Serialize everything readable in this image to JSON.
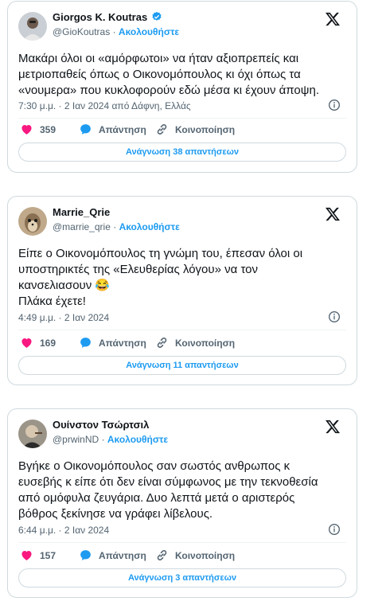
{
  "tweets": [
    {
      "name": "Giorgos K. Koutras",
      "verified": true,
      "handle": "@GioKoutras",
      "follow_label": "Ακολουθήστε",
      "text": "Μακάρι όλοι οι «αμόρφωτοι» να ήταν αξιοπρεπείς και\nμετριοπαθείς όπως ο Οικονομόπουλος κι όχι όπως τα\n«νουμερα» που κυκλοφορούν εδώ μέσα κι έχουν άποψη.",
      "meta": "7:30 μ.μ. · 2 Ιαν 2024 από Δάφνη, Ελλάς",
      "likes": "359",
      "reply_label": "Απάντηση",
      "share_label": "Κοινοποίηση",
      "read_replies": "Ανάγνωση 38 απαντήσεων"
    },
    {
      "name": "Marrie_Qrie",
      "verified": false,
      "handle": "@marrie_qrie",
      "follow_label": "Ακολουθήστε",
      "text": "Είπε ο Οικονομόπουλος τη γνώμη του, έπεσαν όλοι οι\nυποστηρικτές της «Ελευθερίας λόγου» να τον\nκανσελιασουν 😂\nΠλάκα έχετε!",
      "meta": "4:49 μ.μ. · 2 Ιαν 2024",
      "likes": "169",
      "reply_label": "Απάντηση",
      "share_label": "Κοινοποίηση",
      "read_replies": "Ανάγνωση 11 απαντήσεων"
    },
    {
      "name": "Ουίνστον Τσώρτσιλ",
      "verified": false,
      "handle": "@prwinND",
      "follow_label": "Ακολουθήστε",
      "text": "Βγήκε ο Οικονομόπουλος σαν σωστός ανθρωπος κ\nευσεβής κ είπε ότι δεν είναι σύμφωνος με την τεκνοθεσία\nαπό ομόφυλα ζευγάρια. Δυο λεπτά μετά ο αριστερός\nβόθρος ξεκίνησε να γράφει λίβελους.",
      "meta": "6:44 μ.μ. · 2 Ιαν 2024",
      "likes": "157",
      "reply_label": "Απάντηση",
      "share_label": "Κοινοποίηση",
      "read_replies": "Ανάγνωση 3 απαντήσεων"
    }
  ],
  "colors": {
    "accent": "#1d9bf0",
    "like": "#f91880",
    "muted": "#536471",
    "border": "#cfd9de"
  },
  "icons": [
    "avatar",
    "verified-badge-icon",
    "x-logo-icon",
    "info-icon",
    "heart-icon",
    "reply-icon",
    "share-link-icon"
  ]
}
